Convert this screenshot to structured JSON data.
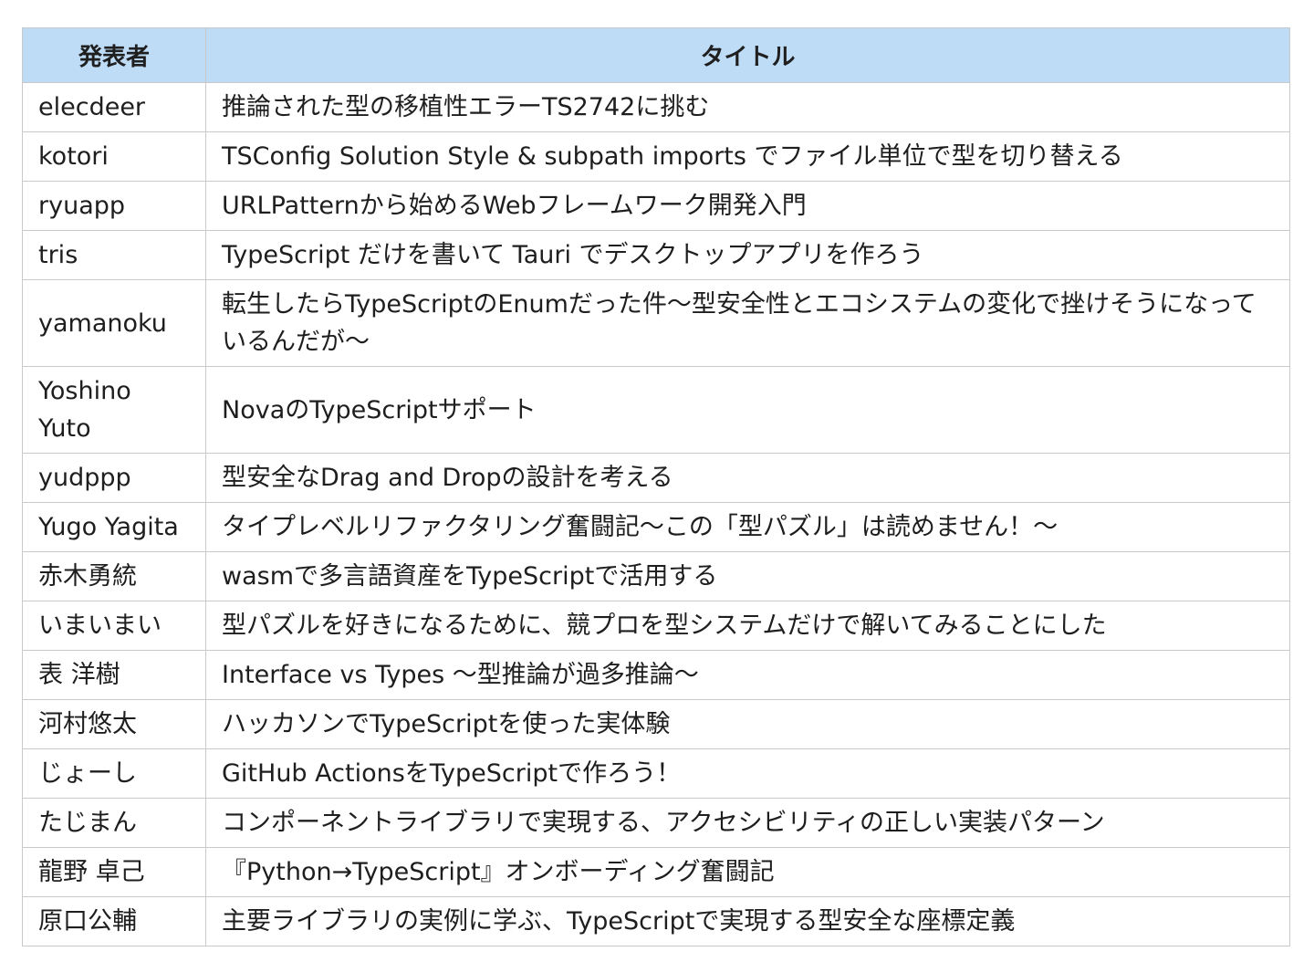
{
  "table": {
    "headers": [
      "発表者",
      "タイトル"
    ],
    "rows": [
      {
        "speaker": "elecdeer",
        "title": "推論された型の移植性エラーTS2742に挑む"
      },
      {
        "speaker": "kotori",
        "title": "TSConfig Solution Style & subpath imports でファイル単位で型を切り替える"
      },
      {
        "speaker": "ryuapp",
        "title": "URLPatternから始めるWebフレームワーク開発入門"
      },
      {
        "speaker": "tris",
        "title": "TypeScript だけを書いて Tauri でデスクトップアプリを作ろう"
      },
      {
        "speaker": "yamanoku",
        "title": "転生したらTypeScriptのEnumだった件〜型安全性とエコシステムの変化で挫けそうになっているんだが〜"
      },
      {
        "speaker": "Yoshino Yuto",
        "title": "NovaのTypeScriptサポート"
      },
      {
        "speaker": "yudppp",
        "title": "型安全なDrag and Dropの設計を考える"
      },
      {
        "speaker": "Yugo Yagita",
        "title": "タイプレベルリファクタリング奮闘記〜この「型パズル」は読めません！〜"
      },
      {
        "speaker": "赤木勇統",
        "title": "wasmで多言語資産をTypeScriptで活用する"
      },
      {
        "speaker": "いまいまい",
        "title": "型パズルを好きになるために、競プロを型システムだけで解いてみることにした"
      },
      {
        "speaker": "表 洋樹",
        "title": "Interface vs Types 〜型推論が過多推論〜"
      },
      {
        "speaker": "河村悠太",
        "title": "ハッカソンでTypeScriptを使った実体験"
      },
      {
        "speaker": "じょーし",
        "title": "GitHub ActionsをTypeScriptで作ろう！"
      },
      {
        "speaker": "たじまん",
        "title": "コンポーネントライブラリで実現する、アクセシビリティの正しい実装パターン"
      },
      {
        "speaker": "龍野 卓己",
        "title": "『Python→TypeScript』オンボーディング奮闘記"
      },
      {
        "speaker": "原口公輔",
        "title": "主要ライブラリの実例に学ぶ、TypeScriptで実現する型安全な座標定義"
      }
    ]
  },
  "colors": {
    "header_bg": "#bfdcf7",
    "border": "#c9c9c9"
  }
}
